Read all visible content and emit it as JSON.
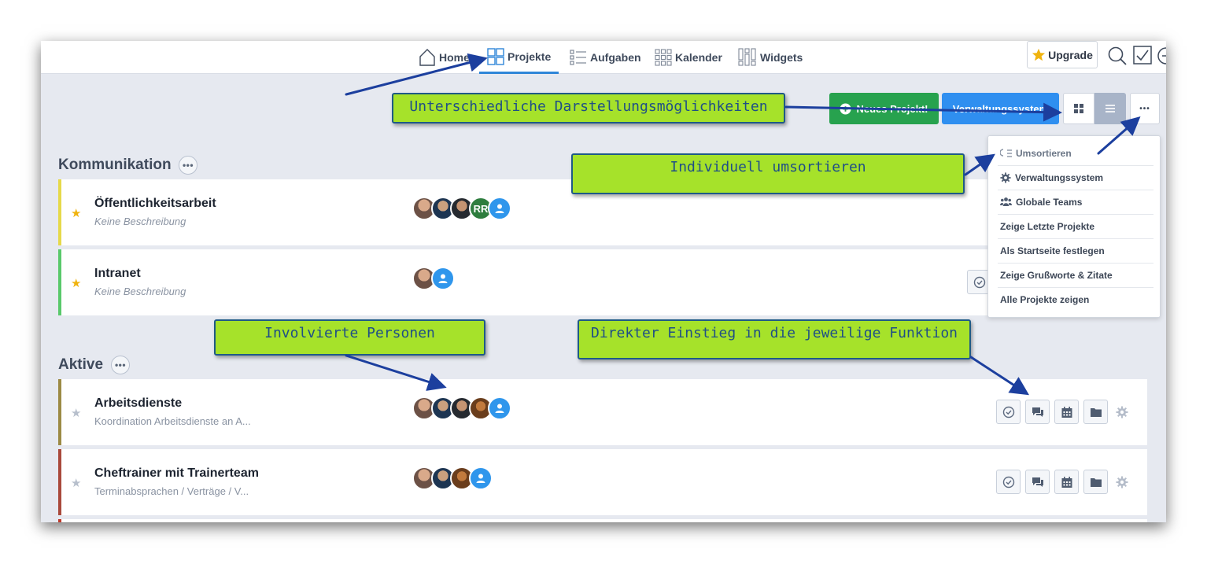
{
  "nav": {
    "home": "Home",
    "projekte": "Projekte",
    "aufgaben": "Aufgaben",
    "kalender": "Kalender",
    "widgets": "Widgets",
    "upgrade": "Upgrade"
  },
  "toolbar": {
    "new_project": "Neues Projekt!",
    "admin_system": "Verwaltungssystem",
    "more": "•••"
  },
  "dropdown": {
    "items": [
      "Umsortieren",
      "Verwaltungssystem",
      "Globale Teams",
      "Zeige Letzte Projekte",
      "Als Startseite festlegen",
      "Zeige Grußworte & Zitate",
      "Alle Projekte zeigen"
    ]
  },
  "sections": {
    "kommunikation": {
      "title": "Kommunikation",
      "dots": "•••",
      "projects": [
        {
          "title": "Öffentlichkeitsarbeit",
          "desc": "Keine Beschreibung",
          "favorite": true,
          "accent": "#e6d94a",
          "initials": "RR"
        },
        {
          "title": "Intranet",
          "desc": "Keine Beschreibung",
          "favorite": true,
          "accent": "#59c96b"
        }
      ]
    },
    "aktive": {
      "title": "Aktive",
      "dots": "•••",
      "projects": [
        {
          "title": "Arbeitsdienste",
          "desc": "Koordination Arbeitsdienste an A...",
          "favorite": false,
          "accent": "#9c8a45"
        },
        {
          "title": "Cheftrainer mit Trainerteam",
          "desc": "Terminabsprachen / Verträge / V...",
          "favorite": false,
          "accent": "#a9493c"
        }
      ]
    }
  },
  "callouts": {
    "views": "Unterschiedliche Darstellungsmöglichkeiten",
    "sort": "Individuell umsortieren",
    "people": "Involvierte Personen",
    "direct": "Direkter Einstieg in die jeweilige Funktion"
  },
  "colors": {
    "accent_blue": "#2f86d8",
    "green_button": "#27a24e",
    "blue_button": "#2f8ff0",
    "callout_bg": "#a6e22a",
    "star_gold": "#f0b30e"
  }
}
